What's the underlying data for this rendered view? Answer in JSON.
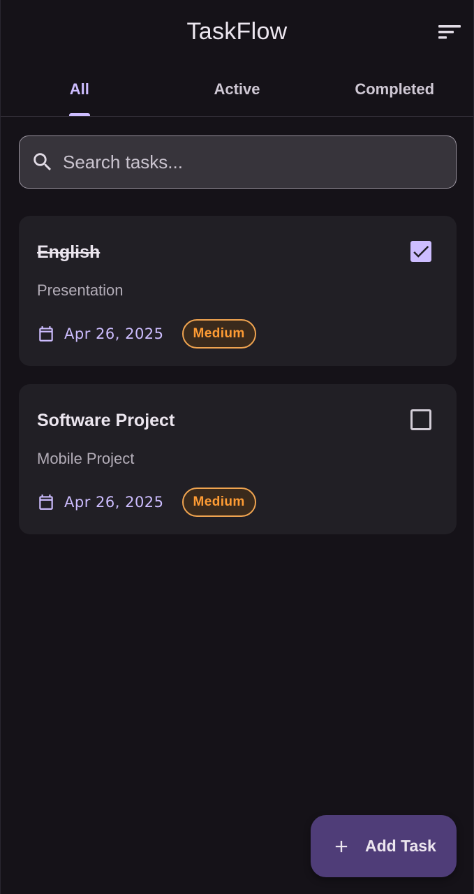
{
  "app": {
    "title": "TaskFlow",
    "sort_icon": "sort-icon"
  },
  "tabs": [
    {
      "label": "All",
      "active": true
    },
    {
      "label": "Active",
      "active": false
    },
    {
      "label": "Completed",
      "active": false
    }
  ],
  "search": {
    "placeholder": "Search tasks...",
    "value": "",
    "icon": "search-icon"
  },
  "tasks": [
    {
      "title": "English",
      "subtitle": "Presentation",
      "date": "Apr 26, 2025",
      "priority": "Medium",
      "completed": true
    },
    {
      "title": "Software Project",
      "subtitle": "Mobile Project",
      "date": "Apr 26, 2025",
      "priority": "Medium",
      "completed": false
    }
  ],
  "fab": {
    "label": "Add Task",
    "icon": "plus-icon"
  },
  "colors": {
    "background": "#151218",
    "surface": "#211f25",
    "accent": "#cdbdff",
    "priority_medium": "#ff9c34",
    "fab": "#4f3d78"
  }
}
